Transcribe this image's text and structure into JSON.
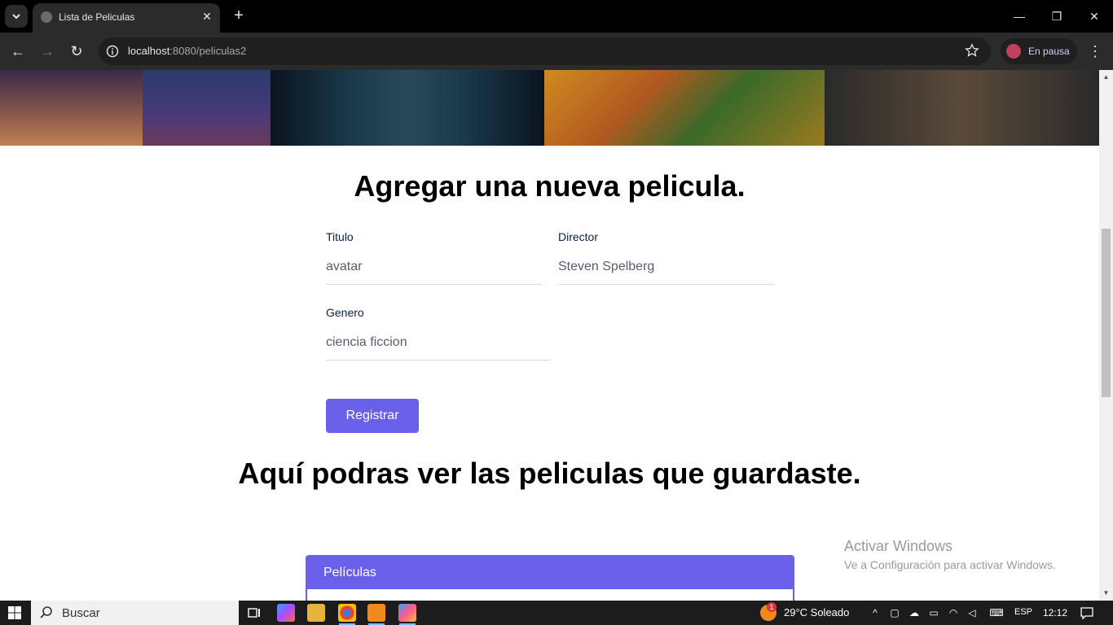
{
  "browser": {
    "tab_title": "Lista de Peliculas",
    "url_host": "localhost",
    "url_path": ":8080/peliculas2",
    "profile_label": "En pausa"
  },
  "page": {
    "add_heading": "Agregar una nueva pelicula.",
    "list_heading": "Aquí podras ver las peliculas que guardaste.",
    "form": {
      "titulo_label": "Titulo",
      "titulo_value": "avatar",
      "director_label": "Director",
      "director_value": "Steven Spelberg",
      "genero_label": "Genero",
      "genero_value": "ciencia ficcion",
      "submit_label": "Registrar"
    },
    "table": {
      "header": "Películas"
    }
  },
  "watermark": {
    "line1": "Activar Windows",
    "line2": "Ve a Configuración para activar Windows."
  },
  "taskbar": {
    "search_placeholder": "Buscar",
    "weather": "29°C  Soleado",
    "weather_badge": "1",
    "language": "ESP",
    "time": "12:12"
  },
  "colors": {
    "accent": "#6a5fe8",
    "chrome_dark": "#2b2b2b"
  }
}
